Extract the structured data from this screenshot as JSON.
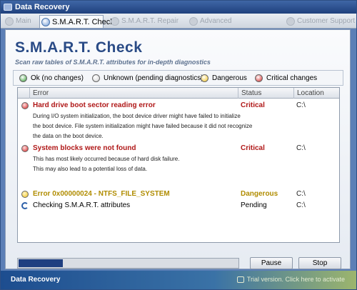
{
  "window": {
    "title": "Data Recovery"
  },
  "tabs": [
    {
      "label": "Main",
      "active": false
    },
    {
      "label": "S.M.A.R.T. Check",
      "active": true
    },
    {
      "label": "S.M.A.R.T. Repair",
      "active": false
    },
    {
      "label": "Advanced",
      "active": false
    },
    {
      "label": "Customer Support",
      "active": false
    }
  ],
  "header": {
    "title": "S.M.A.R.T. Check",
    "subtitle": "Scan raw tables of S.M.A.R.T. attributes for in-depth diagnostics"
  },
  "legend": [
    {
      "label": "Ok (no changes)",
      "color": "#2f9a2f"
    },
    {
      "label": "Unknown (pending diagnostics)",
      "color": "#d0d0d0"
    },
    {
      "label": "Dangerous",
      "color": "#f2c21a"
    },
    {
      "label": "Critical changes",
      "color": "#d21f1f"
    }
  ],
  "table": {
    "columns": [
      "Error",
      "Status",
      "Location"
    ],
    "rows": [
      {
        "title": "Hard drive boot sector reading error",
        "description": [
          "During I/O system initialization, the boot device driver might have failed to initialize",
          "the boot device. File system initialization might have failed because it did not recognize",
          "the data on the boot device."
        ],
        "status": "Critical",
        "location": "C:\\",
        "icon": "critical",
        "color": "#b01818"
      },
      {
        "title": "System blocks were not found",
        "description": [
          "This has most likely occurred because of hard disk failure.",
          "This may also lead to a potential loss of data."
        ],
        "status": "Critical",
        "location": "C:\\",
        "icon": "critical",
        "color": "#b01818"
      },
      {
        "title": "Error 0x00000024 - NTFS_FILE_SYSTEM",
        "description": [],
        "status": "Dangerous",
        "location": "C:\\",
        "icon": "dangerous",
        "color": "#b08c00"
      },
      {
        "title": "Checking S.M.A.R.T. attributes",
        "description": [],
        "status": "Pending",
        "location": "C:\\",
        "icon": "pending",
        "color": "#000000"
      }
    ]
  },
  "progress": {
    "value": 0.2
  },
  "buttons": {
    "pause": "Pause",
    "stop": "Stop"
  },
  "footer": {
    "left": "Data Recovery",
    "right": "Trial version. Click here to activate"
  }
}
